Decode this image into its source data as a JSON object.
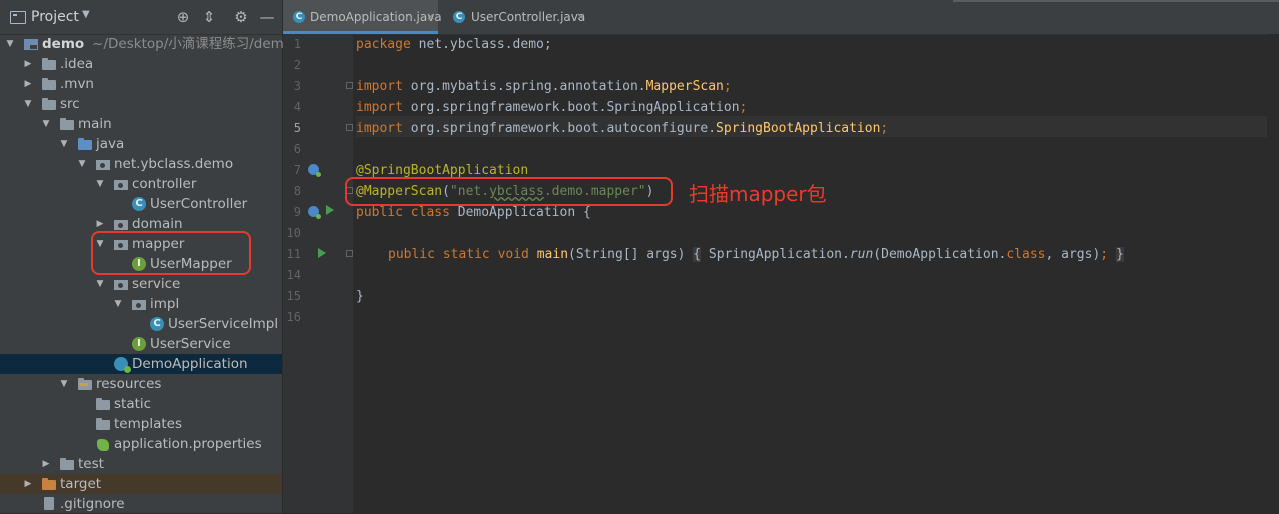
{
  "project_panel": {
    "title": "Project",
    "tree": [
      {
        "label": "demo",
        "path": "~/Desktop/小滴课程练习/demo",
        "icon": "module-folder-icon",
        "expanded": true
      },
      {
        "label": ".idea",
        "icon": "folder-icon",
        "expanded": false
      },
      {
        "label": ".mvn",
        "icon": "folder-icon",
        "expanded": false
      },
      {
        "label": "src",
        "icon": "folder-icon",
        "expanded": true
      },
      {
        "label": "main",
        "icon": "folder-icon",
        "expanded": true
      },
      {
        "label": "java",
        "icon": "source-folder-icon",
        "expanded": true
      },
      {
        "label": "net.ybclass.demo",
        "icon": "package-icon",
        "expanded": true
      },
      {
        "label": "controller",
        "icon": "package-icon",
        "expanded": true
      },
      {
        "label": "UserController",
        "icon": "class-icon",
        "badge": "C"
      },
      {
        "label": "domain",
        "icon": "package-icon",
        "expanded": false
      },
      {
        "label": "mapper",
        "icon": "package-icon",
        "expanded": true
      },
      {
        "label": "UserMapper",
        "icon": "interface-icon",
        "badge": "I"
      },
      {
        "label": "service",
        "icon": "package-icon",
        "expanded": true
      },
      {
        "label": "impl",
        "icon": "package-icon",
        "expanded": true
      },
      {
        "label": "UserServiceImpl",
        "icon": "class-icon",
        "badge": "C"
      },
      {
        "label": "UserService",
        "icon": "interface-icon",
        "badge": "I"
      },
      {
        "label": "DemoApplication",
        "icon": "spring-boot-class-icon",
        "selected": true
      },
      {
        "label": "resources",
        "icon": "resources-folder-icon",
        "expanded": true
      },
      {
        "label": "static",
        "icon": "folder-icon"
      },
      {
        "label": "templates",
        "icon": "folder-icon"
      },
      {
        "label": "application.properties",
        "icon": "properties-icon"
      },
      {
        "label": "test",
        "icon": "folder-icon",
        "expanded": false
      },
      {
        "label": "target",
        "icon": "excluded-folder-icon",
        "expanded": false
      },
      {
        "label": ".gitignore",
        "icon": "gitignore-icon"
      }
    ]
  },
  "tabs": [
    {
      "label": "DemoApplication.java",
      "badge": "C",
      "active": true
    },
    {
      "label": "UserController.java",
      "badge": "C",
      "active": false
    }
  ],
  "tab_close_glyph": "×",
  "editor": {
    "line_numbers": [
      "1",
      "2",
      "3",
      "4",
      "5",
      "6",
      "7",
      "8",
      "9",
      "10",
      "11",
      "14",
      "15",
      "16"
    ],
    "current_line": "5",
    "line1": {
      "kw": "package",
      "rest": " net.ybclass.demo;"
    },
    "line3": {
      "kw": "import",
      "rest": " org.mybatis.spring.annotation.",
      "cls": "MapperScan",
      "end": ";"
    },
    "line4": {
      "kw": "import",
      "rest": " org.springframework.boot.SpringApplication",
      "end": ";"
    },
    "line5": {
      "kw": "import",
      "rest": " org.springframework.boot.autoconfigure.",
      "cls": "SpringBootApplication",
      "end": ";"
    },
    "line7": {
      "ann": "@SpringBootApplication"
    },
    "line8": {
      "ann": "@MapperScan",
      "open": "(",
      "str_a": "\"net.",
      "str_b": "ybclass",
      "str_c": ".demo.mapper\"",
      "close": ")"
    },
    "line9": {
      "kw": "public class",
      "rest": " DemoApplication {"
    },
    "line11": {
      "kw": "public static void",
      "name": "main",
      "params": "(String[] args)",
      "fold_open": "{",
      "call_a": " SpringApplication.",
      "call_fn": "run",
      "call_b": "(DemoApplication.",
      "call_kw": "class",
      "call_c": ", args)",
      "call_end": ";",
      "fold_close": "}"
    },
    "line15": {
      "text": "}"
    }
  },
  "annotation": {
    "text": "扫描mapper包",
    "color": "#ee3a2b"
  },
  "header_icons": [
    "target-icon",
    "collapse-icon",
    "gear-icon",
    "minimize-icon"
  ]
}
